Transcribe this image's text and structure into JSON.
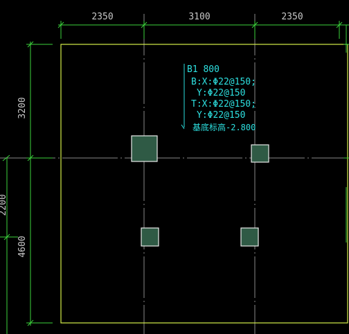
{
  "colors": {
    "background": "#000000",
    "dimension_line": "#3dd43d",
    "slab_outline": "#d6f04a",
    "axis_line": "#8a8a8a",
    "column_fill": "#2f5a45",
    "column_stroke": "#e8e8e8",
    "annotation_text": "#2de0e0",
    "dimension_text": "#c8c8c8"
  },
  "dimensions": {
    "top": [
      "2350",
      "3100",
      "2350"
    ],
    "left": [
      "3200",
      "4600"
    ],
    "left_partial": "2200"
  },
  "annotation": {
    "lines": [
      "B1 800",
      "B:X:Φ22@150;",
      "Y:Φ22@150",
      "T:X:Φ22@150;",
      "Y:Φ22@150",
      "基底标高-2.800"
    ]
  },
  "columns": [
    {
      "id": "upper-left",
      "highlight": true
    },
    {
      "id": "upper-right",
      "highlight": false
    },
    {
      "id": "lower-left",
      "highlight": false
    },
    {
      "id": "lower-right",
      "highlight": false
    }
  ]
}
